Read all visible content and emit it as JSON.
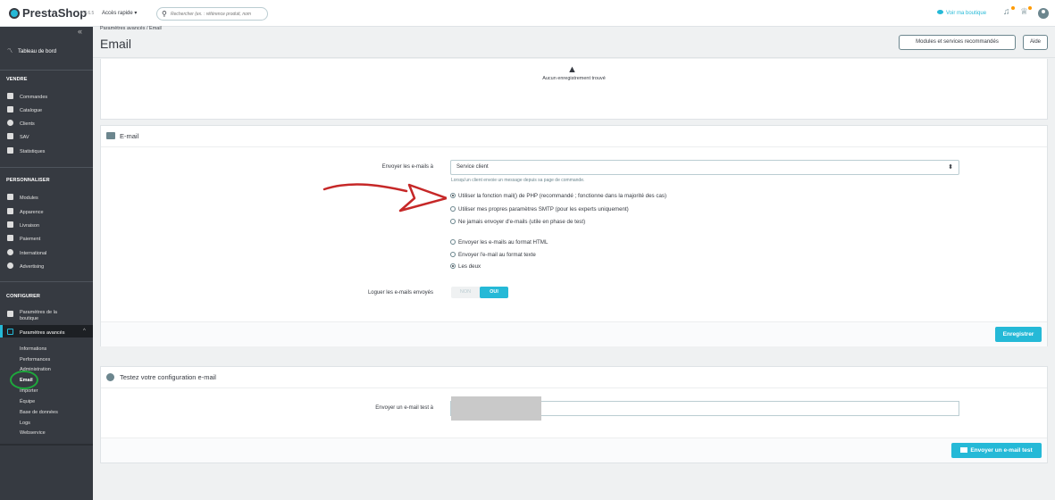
{
  "topbar": {
    "brand": "PrestaShop",
    "version": "1.7.6.5",
    "quick_access": "Accès rapide ▾",
    "search_placeholder": "Rechercher (ex. : référence produit, nom",
    "view_shop": "Voir ma boutique",
    "icons": [
      "bell-icon",
      "trophy-icon",
      "user-icon"
    ]
  },
  "sidebar": {
    "collapse": "«",
    "dashboard": "Tableau de bord",
    "sections": [
      {
        "title": "VENDRE",
        "items": [
          "Commandes",
          "Catalogue",
          "Clients",
          "SAV",
          "Statistiques"
        ]
      },
      {
        "title": "PERSONNALISER",
        "items": [
          "Modules",
          "Apparence",
          "Livraison",
          "Paiement",
          "International",
          "Advertising"
        ]
      },
      {
        "title": "CONFIGURER",
        "items": [
          "Paramètres de la boutique",
          "Paramètres avancés"
        ]
      }
    ],
    "advanced_label": "Paramètres avancés",
    "advanced_chevron": "^",
    "submenu": [
      "Informations",
      "Performances",
      "Administration",
      "Email",
      "Importer",
      "Équipe",
      "Base de données",
      "Logs",
      "Webservice"
    ]
  },
  "header": {
    "breadcrumb": "Paramètres avancés  /  Email",
    "title": "Email",
    "btn_modules": "Modules et services recommandés",
    "btn_help": "Aide"
  },
  "empty_panel": {
    "warning": "▲",
    "message": "Aucun enregistrement trouvé"
  },
  "email_panel": {
    "title": "E-mail",
    "send_label": "Envoyer les e-mails à",
    "send_value": "Service client",
    "select_arrows": "⬍",
    "send_help": "Lorsqu'un client envoie un message depuis sa page de commande.",
    "method_options": [
      {
        "label": "Utiliser la fonction mail() de PHP (recommandé ; fonctionne dans la majorité des cas)",
        "checked": true
      },
      {
        "label": "Utiliser mes propres paramètres SMTP (pour les experts uniquement)",
        "checked": false
      },
      {
        "label": "Ne jamais envoyer d'e-mails (utile en phase de test)",
        "checked": false
      }
    ],
    "format_options": [
      {
        "label": "Envoyer les e-mails au format HTML",
        "checked": false
      },
      {
        "label": "Envoyer l'e-mail au format texte",
        "checked": false
      },
      {
        "label": "Les deux",
        "checked": true
      }
    ],
    "log_label": "Loguer les e-mails envoyés",
    "log_no": "NON",
    "log_yes": "OUI",
    "save": "Enregistrer"
  },
  "test_panel": {
    "title": "Testez votre configuration e-mail",
    "label": "Envoyer un e-mail test à",
    "value": "",
    "button": "Envoyer un e-mail test"
  },
  "colors": {
    "accent": "#25b9d7",
    "sidebar": "#363a41",
    "annotation_arrow": "#c62828",
    "annotation_circle": "#1ea83c"
  }
}
